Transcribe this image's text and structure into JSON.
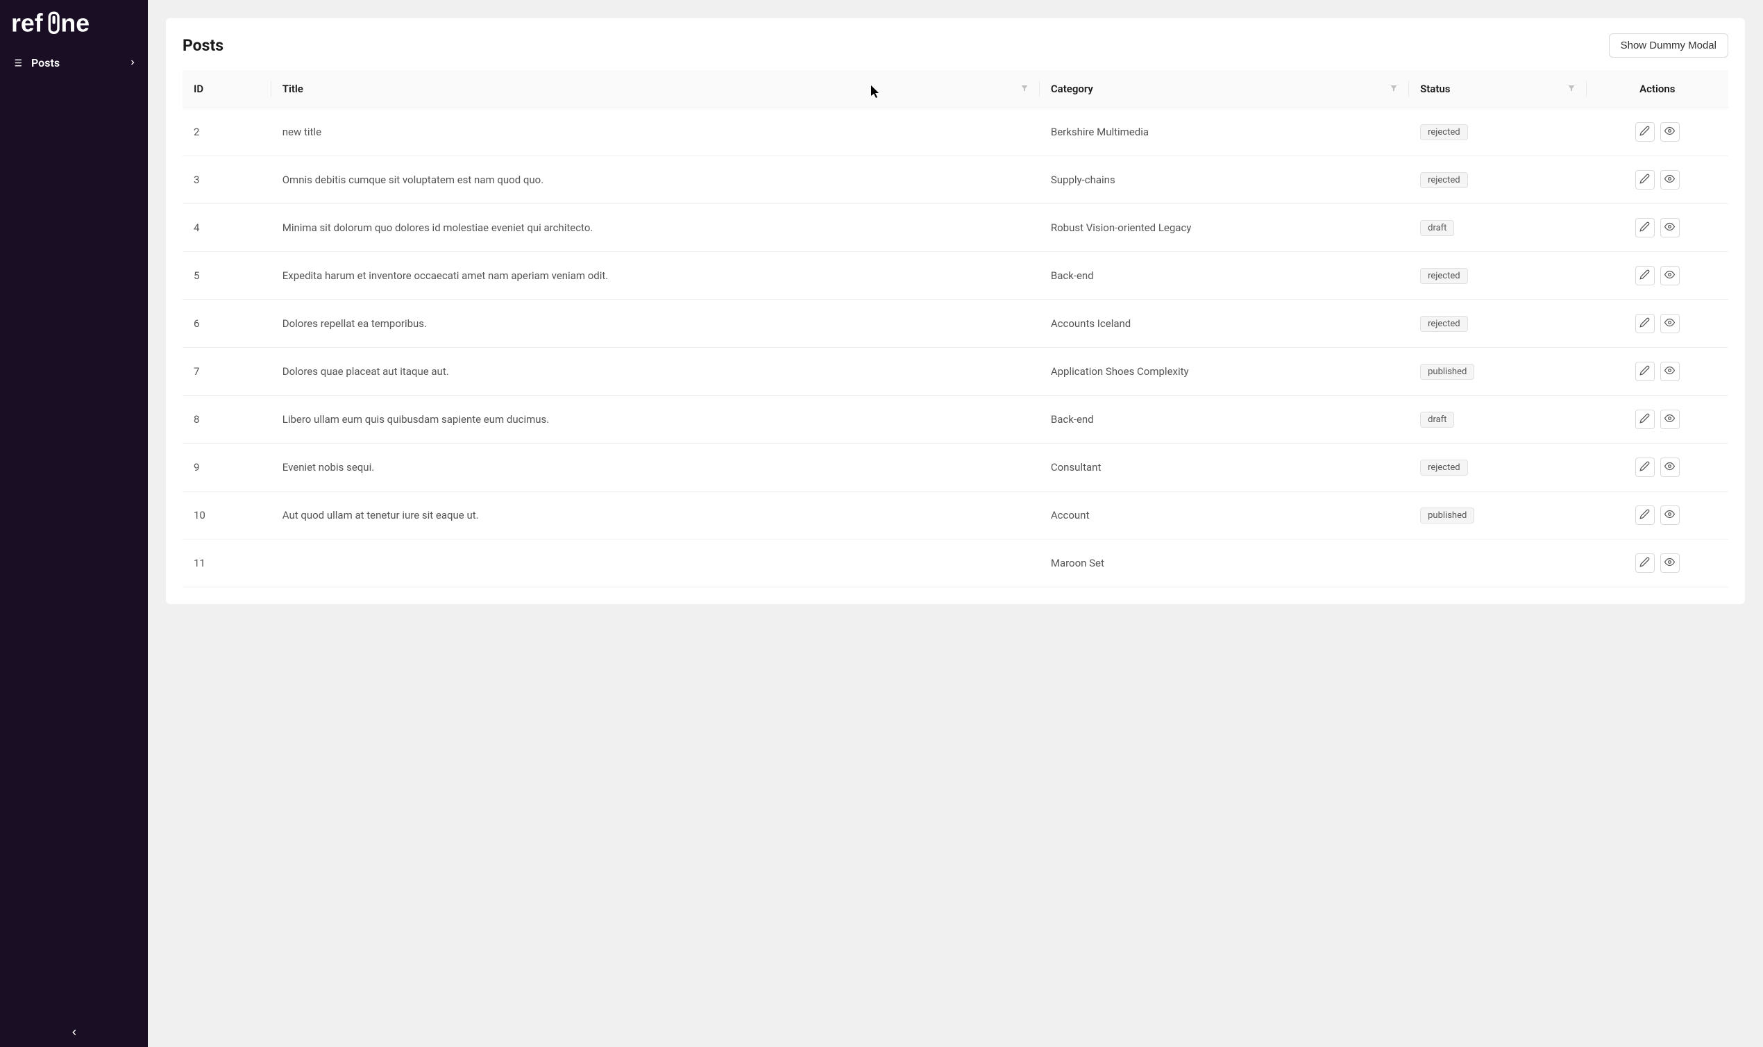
{
  "sidebar": {
    "logo_text": "refine",
    "nav": {
      "posts": "Posts"
    }
  },
  "page": {
    "title": "Posts",
    "modal_button": "Show Dummy Modal"
  },
  "table": {
    "columns": {
      "id": "ID",
      "title": "Title",
      "category": "Category",
      "status": "Status",
      "actions": "Actions"
    },
    "rows": [
      {
        "id": "2",
        "title": "new title",
        "category": "Berkshire Multimedia",
        "status": "rejected"
      },
      {
        "id": "3",
        "title": "Omnis debitis cumque sit voluptatem est nam quod quo.",
        "category": "Supply-chains",
        "status": "rejected"
      },
      {
        "id": "4",
        "title": "Minima sit dolorum quo dolores id molestiae eveniet qui architecto.",
        "category": "Robust Vision-oriented Legacy",
        "status": "draft"
      },
      {
        "id": "5",
        "title": "Expedita harum et inventore occaecati amet nam aperiam veniam odit.",
        "category": "Back-end",
        "status": "rejected"
      },
      {
        "id": "6",
        "title": "Dolores repellat ea temporibus.",
        "category": "Accounts Iceland",
        "status": "rejected"
      },
      {
        "id": "7",
        "title": "Dolores quae placeat aut itaque aut.",
        "category": "Application Shoes Complexity",
        "status": "published"
      },
      {
        "id": "8",
        "title": "Libero ullam eum quis quibusdam sapiente eum ducimus.",
        "category": "Back-end",
        "status": "draft"
      },
      {
        "id": "9",
        "title": "Eveniet nobis sequi.",
        "category": "Consultant",
        "status": "rejected"
      },
      {
        "id": "10",
        "title": "Aut quod ullam at tenetur iure sit eaque ut.",
        "category": "Account",
        "status": "published"
      },
      {
        "id": "11",
        "title": "",
        "category": "Maroon Set",
        "status": ""
      }
    ]
  }
}
